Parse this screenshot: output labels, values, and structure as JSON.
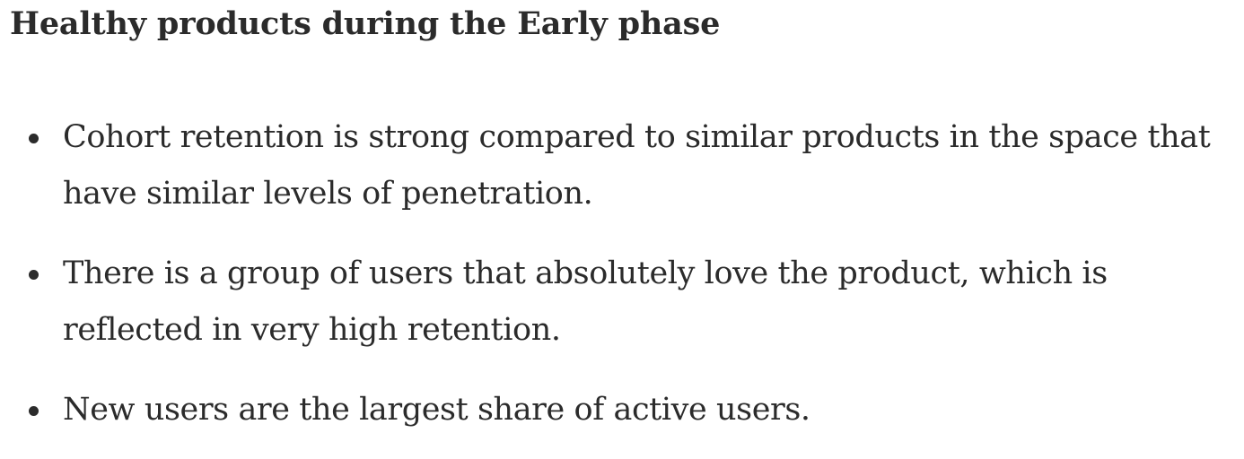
{
  "document": {
    "heading": "Healthy products during the Early phase",
    "bullets": [
      {
        "text": "Cohort retention is strong compared to similar products in the space that have similar levels of penetration."
      },
      {
        "text": "There is a group of users that absolutely love the product, which is reflected in very high retention."
      },
      {
        "text": "New users are the largest share of active users."
      }
    ]
  }
}
